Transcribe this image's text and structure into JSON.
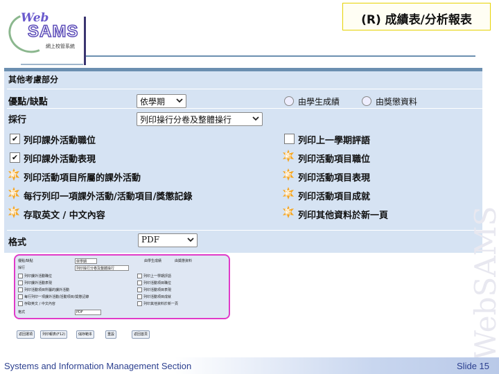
{
  "header": {
    "title": "(R) 成績表/分析報表",
    "logo": {
      "brand_top": "Web",
      "brand_main": "SAMS",
      "brand_sub": "網上校管系統"
    }
  },
  "panel": {
    "heading": "其他考慮部分",
    "merit_label": "優點/缺點",
    "merit_select": "依學期",
    "radio_student": "由學生成績",
    "radio_award": "由獎懲資料",
    "sort_label": "採行",
    "sort_select": "列印操行分卷及整體操行",
    "options_left": [
      {
        "label": "列印課外活動職位",
        "checked": true,
        "new": false
      },
      {
        "label": "列印課外活動表現",
        "checked": true,
        "new": false
      },
      {
        "label": "列印活動項目所屬的課外活動",
        "checked": false,
        "new": true
      },
      {
        "label": "每行列印一項課外活動/活動項目/獎懲記錄",
        "checked": false,
        "new": true
      },
      {
        "label": "存取英文 / 中文內容",
        "checked": false,
        "new": true
      }
    ],
    "options_right": [
      {
        "label": "列印上一學期評語",
        "checked": false,
        "new": false
      },
      {
        "label": "列印活動項目職位",
        "checked": false,
        "new": true
      },
      {
        "label": "列印活動項目表現",
        "checked": false,
        "new": true
      },
      {
        "label": "列印活動項目成就",
        "checked": false,
        "new": true
      },
      {
        "label": "列印其他資料於新一頁",
        "checked": false,
        "new": true
      }
    ],
    "new_mark": "新",
    "format_label": "格式",
    "format_select": "PDF"
  },
  "preview": {
    "row1_label": "優點/缺點",
    "row1_select": "依學期",
    "row1_r1": "由學生成績",
    "row1_r2": "由獎懲資料",
    "row2_label": "採行",
    "row2_select": "列印操行分卷及整體操行",
    "left": [
      "列印課外活動職位",
      "列印課外活動表現",
      "列印活動項目所屬的課外活動",
      "每行列印一項課外活動/活動項目/獎懲記錄",
      "存取英文 / 中文內容"
    ],
    "right": [
      "列印上一學期評語",
      "列印活動項目職位",
      "列印活動項目表現",
      "列印活動項目成就",
      "列印其他資料於新一頁"
    ],
    "format_label": "格式",
    "format_select": "PDF",
    "buttons": [
      "返回選項",
      "列印報表(F12)",
      "儲存範本",
      "重設",
      "返回首頁"
    ]
  },
  "footer": {
    "left": "Systems and Information Management Section",
    "right": "Slide 15"
  },
  "watermark": "WebSAMS",
  "colors": {
    "panel_bg": "#d6e3f3",
    "panel_border": "#6b8fb0",
    "highlight": "#e03ac8",
    "title_border": "#e6d200"
  }
}
